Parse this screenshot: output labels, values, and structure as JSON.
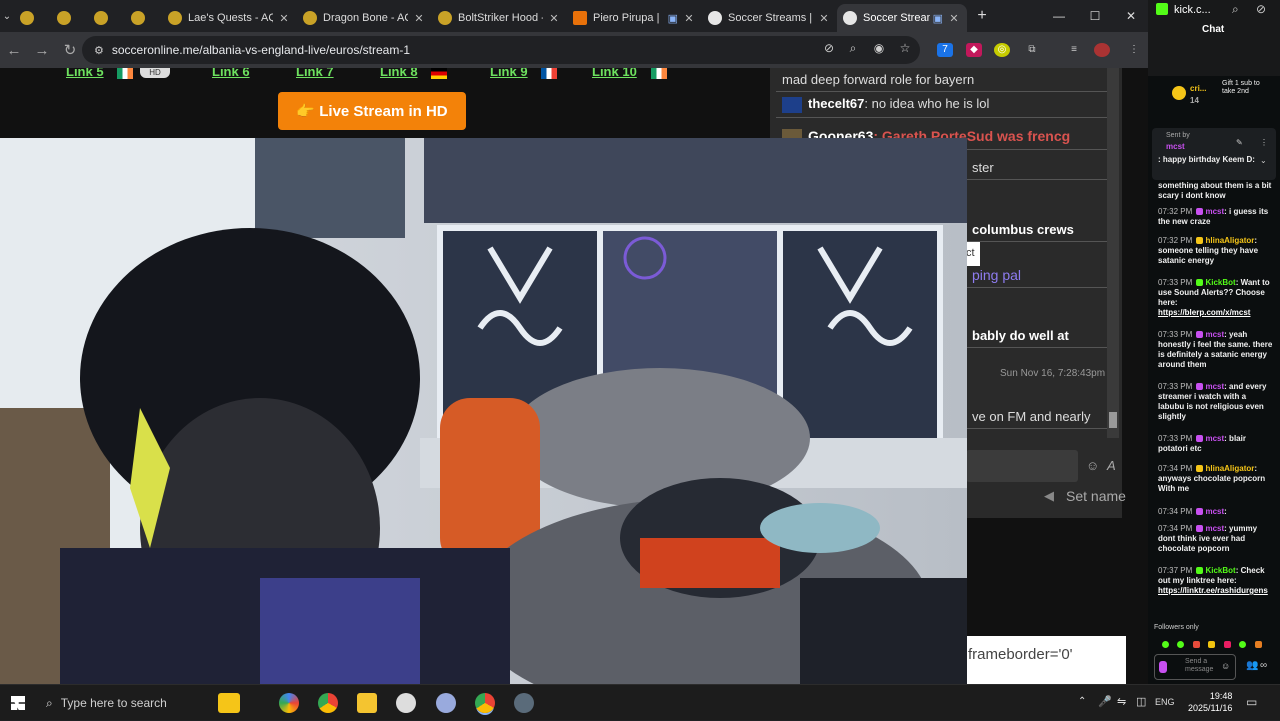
{
  "browser": {
    "tabs": [
      {
        "title": "",
        "active": false
      },
      {
        "title": "",
        "active": false
      },
      {
        "title": "",
        "active": false
      },
      {
        "title": "",
        "active": false
      },
      {
        "title": "Lae's Quests - AQ",
        "active": false
      },
      {
        "title": "Dragon Bone - AQ",
        "active": false
      },
      {
        "title": "BoltStriker Hood -",
        "active": false
      },
      {
        "title": "Piero Pirupa |",
        "active": false
      },
      {
        "title": "Soccer Streams | V",
        "active": false
      },
      {
        "title": "Soccer Stream",
        "active": true
      }
    ],
    "new_tab_label": "+",
    "url": "socceronline.me/albania-vs-england-live/euros/stream-1"
  },
  "page": {
    "links": [
      "Link 5",
      "Link 6",
      "Link 7",
      "Link 8",
      "Link 9",
      "Link 10"
    ],
    "hd_badge": "HD",
    "live_button": "👉 Live Stream in HD",
    "chat_messages": [
      {
        "user": "",
        "text": "mad deep forward role for bayern"
      },
      {
        "user": "thecelt67",
        "text": ": no idea who he is lol"
      },
      {
        "user": "Gooner63",
        "text": ": Gareth PorteSud was frencg"
      },
      {
        "user": "",
        "text": "ster"
      },
      {
        "user": "",
        "text": "columbus crews"
      },
      {
        "user": "",
        "text": "ping pal"
      },
      {
        "user": "",
        "text": "bably do well at"
      },
      {
        "user": "",
        "text": "ve on FM and nearly"
      }
    ],
    "chat_timestamp": "Sun Nov 16, 7:28:43pm",
    "popup_fragment": "ct",
    "set_name": "Set name",
    "frameborder_text": "frameborder='0'"
  },
  "kick": {
    "channel": "kick.c...",
    "chat_title": "Chat",
    "gift_user": "cri...",
    "gift_count": "14",
    "gift_text": "Gift 1 sub to take 2nd",
    "sent_by": "Sent by",
    "pinned_user": "mcst",
    "pinned_text": ": happy birthday Keem D:",
    "partial_text": "something about them is a bit scary i dont know",
    "messages": [
      {
        "time": "07:32 PM",
        "user": "mcst",
        "text": ": i guess its the new craze",
        "kind": "p"
      },
      {
        "time": "07:32 PM",
        "user": "hlinaAligator",
        "text": ": someone telling they have satanic energy",
        "kind": "g"
      },
      {
        "time": "07:33 PM",
        "user": "KickBot",
        "text": ": Want to use Sound Alerts?? Choose here:",
        "link": "https://blerp.com/x/mcst",
        "kind": "k"
      },
      {
        "time": "07:33 PM",
        "user": "mcst",
        "text": ": yeah honestly i feel the same. there is definitely a satanic energy around them",
        "kind": "p"
      },
      {
        "time": "07:33 PM",
        "user": "mcst",
        "text": ": and every streamer i watch with a labubu is not religious even slightly",
        "kind": "p"
      },
      {
        "time": "07:33 PM",
        "user": "mcst",
        "text": ": blair potatori etc",
        "kind": "p"
      },
      {
        "time": "07:34 PM",
        "user": "hlinaAligator",
        "text": ": anyways chocolate popcorn With me",
        "kind": "g"
      },
      {
        "time": "07:34 PM",
        "user": "mcst",
        "text": ":",
        "kind": "p"
      },
      {
        "time": "07:34 PM",
        "user": "mcst",
        "text": ": yummy dont think ive ever had chocolate popcorn",
        "kind": "p"
      },
      {
        "time": "07:37 PM",
        "user": "KickBot",
        "text": ": Check out my linktree here:",
        "link": "https://linktr.ee/rashidurgens",
        "kind": "k"
      }
    ],
    "followers_only": "Followers only",
    "send_placeholder": "Send a message"
  },
  "taskbar": {
    "search_placeholder": "Type here to search",
    "lang": "ENG",
    "time": "19:48",
    "date": "2025/11/16"
  }
}
